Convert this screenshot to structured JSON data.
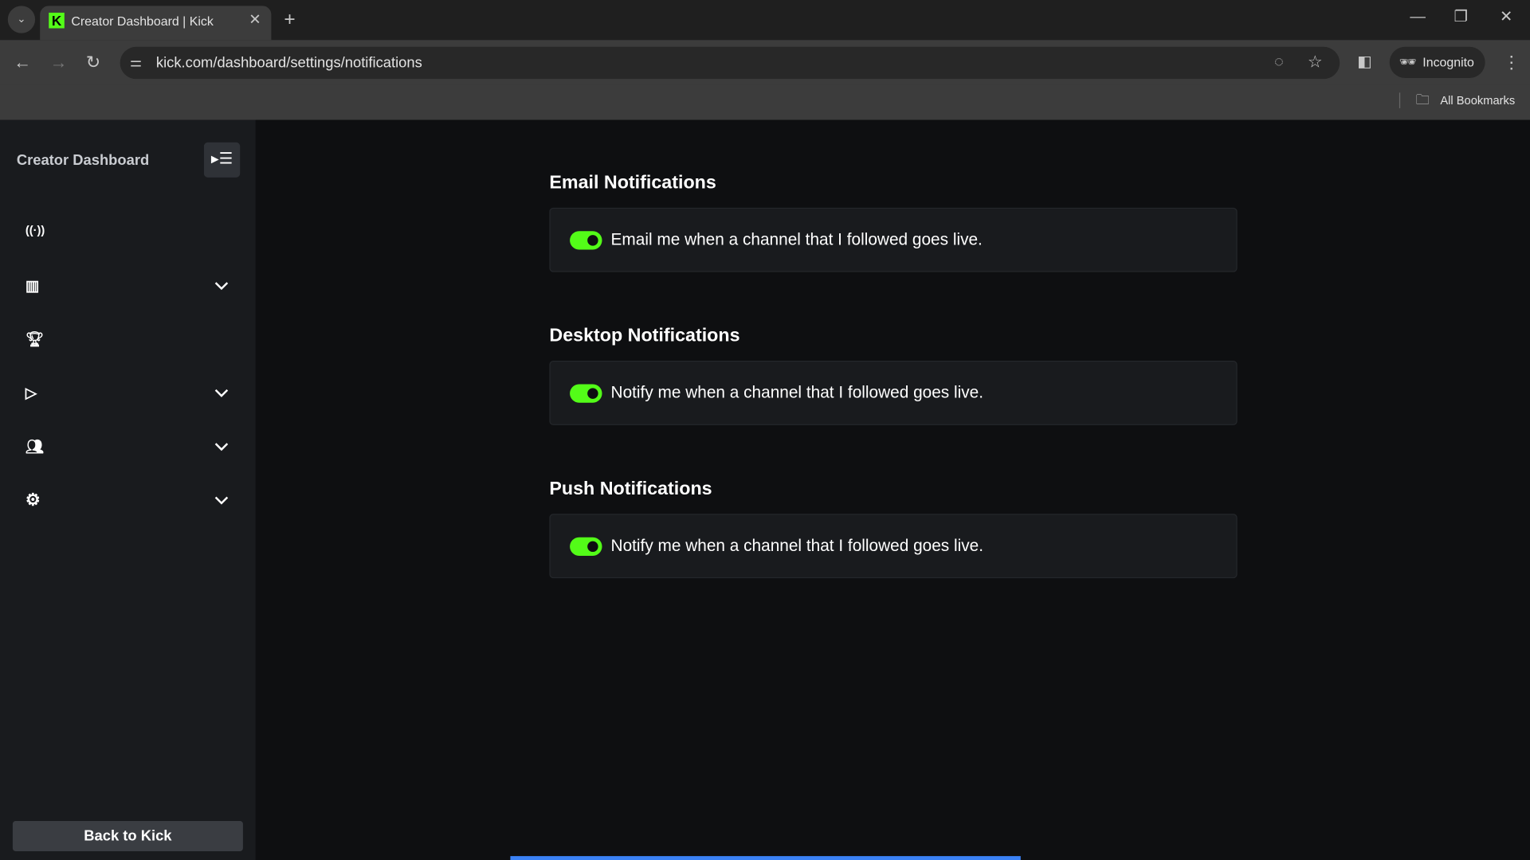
{
  "browser": {
    "tab_title": "Creator Dashboard | Kick",
    "url": "kick.com/dashboard/settings/notifications",
    "incognito_label": "Incognito",
    "bookmarks_label": "All Bookmarks"
  },
  "sidebar": {
    "title": "Creator Dashboard",
    "items": [
      {
        "icon": "broadcast-icon",
        "expandable": false
      },
      {
        "icon": "analytics-icon",
        "expandable": true
      },
      {
        "icon": "trophy-icon",
        "expandable": false
      },
      {
        "icon": "video-icon",
        "expandable": true
      },
      {
        "icon": "community-icon",
        "expandable": true
      },
      {
        "icon": "settings-icon",
        "expandable": true
      }
    ],
    "back_label": "Back to Kick"
  },
  "sections": [
    {
      "title": "Email Notifications",
      "label": "Email me when a channel that I followed goes live.",
      "enabled": true
    },
    {
      "title": "Desktop Notifications",
      "label": "Notify me when a channel that I followed goes live.",
      "enabled": true
    },
    {
      "title": "Push Notifications",
      "label": "Notify me when a channel that I followed goes live.",
      "enabled": true
    }
  ],
  "colors": {
    "accent": "#53fc18",
    "sidebar": "#191b1e",
    "background": "#0e0f11"
  }
}
